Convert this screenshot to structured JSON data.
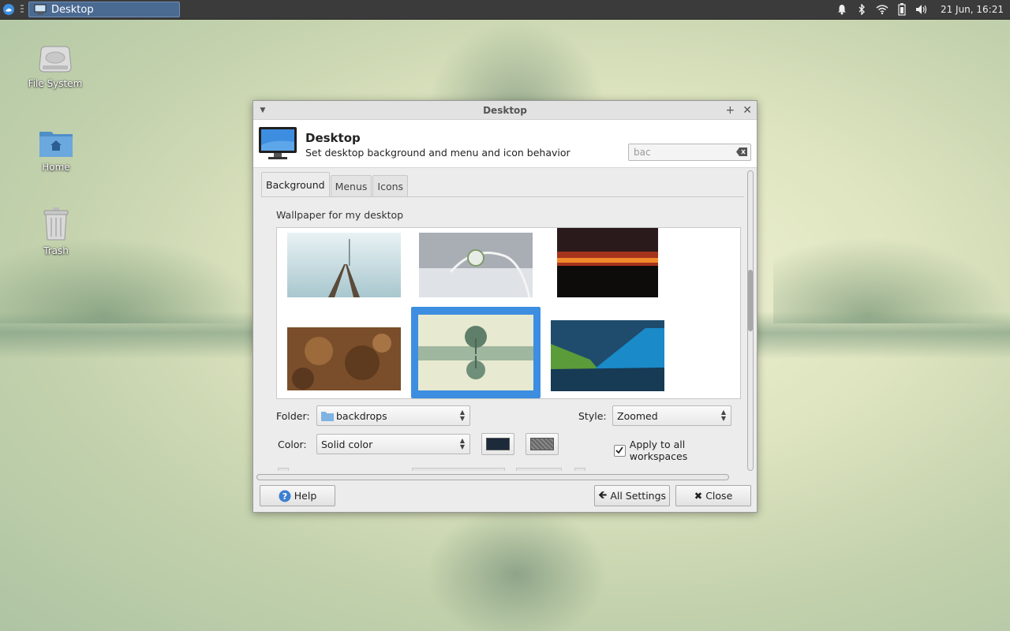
{
  "taskbar": {
    "window_button_label": "Desktop",
    "clock": "21 Jun, 16:21",
    "tray_icons": [
      "bell-icon",
      "bluetooth-icon",
      "wifi-icon",
      "battery-icon",
      "volume-icon"
    ]
  },
  "desktop_icons": [
    {
      "label": "File System",
      "icon": "drive-icon"
    },
    {
      "label": "Home",
      "icon": "home-folder-icon"
    },
    {
      "label": "Trash",
      "icon": "trash-icon"
    }
  ],
  "window": {
    "title": "Desktop",
    "header_title": "Desktop",
    "header_subtitle": "Set desktop background and menu and icon behavior",
    "search": {
      "value": "bac",
      "placeholder": ""
    },
    "tabs": [
      {
        "label": "Background",
        "active": true
      },
      {
        "label": "Menus",
        "active": false
      },
      {
        "label": "Icons",
        "active": false
      }
    ],
    "wallpaper_label": "Wallpaper for my desktop",
    "wallpapers": [
      "foggy-railway",
      "frosted-plant",
      "sunset-silhouette",
      "carved-relief",
      "reflected-tree",
      "teal-green-abstract"
    ],
    "selected_wallpaper": "reflected-tree",
    "folder_label": "Folder:",
    "folder_value": "backdrops",
    "style_label": "Style:",
    "style_value": "Zoomed",
    "color_label": "Color:",
    "color_value": "Solid color",
    "apply_all_label": "Apply to all workspaces",
    "apply_all_checked": true,
    "primary_color": "#1c2a3a",
    "buttons": {
      "help": "Help",
      "all_settings": "All Settings",
      "close": "Close"
    }
  },
  "colors": {
    "panel": "#3b3b3b",
    "selection": "#3d8ee0",
    "task_button": "#4a6a92"
  }
}
